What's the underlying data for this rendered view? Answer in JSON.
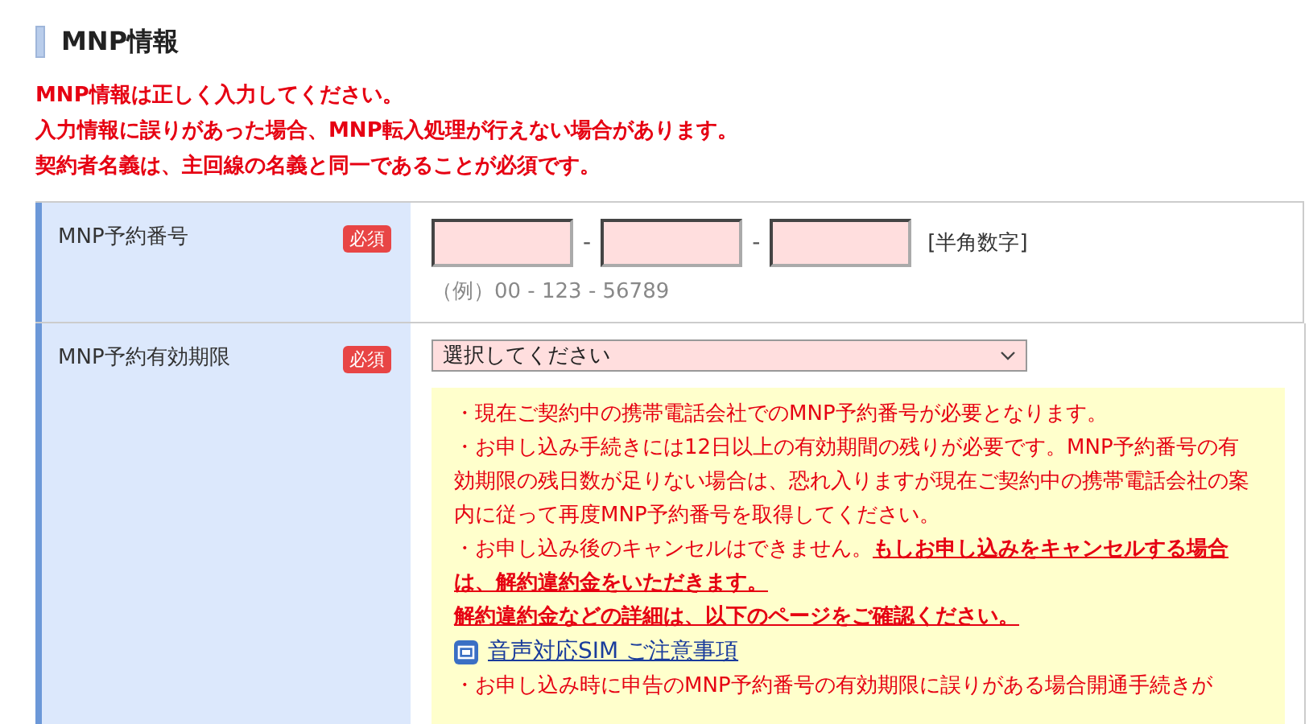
{
  "section": {
    "title": "MNP情報"
  },
  "warnings": [
    "MNP情報は正しく入力してください。",
    "入力情報に誤りがあった場合、MNP転入処理が行えない場合があります。",
    "契約者名義は、主回線の名義と同一であることが必須です。"
  ],
  "rows": [
    {
      "label": "MNP予約番号",
      "required_badge": "必須",
      "kind": "number",
      "separators": [
        "-",
        "-"
      ],
      "fields": [
        {
          "kind": "box"
        },
        {
          "kind": "box"
        },
        {
          "kind": "box"
        }
      ],
      "hint": "[半角数字]",
      "example": "（例）00 - 123 - 56789"
    },
    {
      "label": "MNP予約有効期限",
      "required_badge": "必須",
      "kind": "select",
      "select": {
        "value": "選択してください"
      },
      "notes": [
        {
          "kind": "bullet",
          "text": "・現在ご契約中の携帯電話会社でのMNP予約番号が必要となります。"
        },
        {
          "kind": "bullet",
          "text": "・お申し込み手続きには12日以上の有効期間の残りが必要です。MNP予約番号の有効期限の残日数が足りない場合は、恐れ入りますが現在ご契約中の携帯電話会社の案内に従って再度MNP予約番号を取得してください。"
        },
        {
          "kind": "bullet",
          "text": "・お申し込み後のキャンセルはできません。",
          "strong_text": "もしお申し込みをキャンセルする場合は、解約違約金をいただきます。"
        },
        {
          "kind": "emphasis",
          "text": "解約違約金などの詳細は、以下のページをご確認ください。"
        },
        {
          "kind": "link",
          "text": "音声対応SIM ご注意事項"
        },
        {
          "kind": "bullet",
          "text": "・お申し込み時に申告のMNP予約番号の有効期限に誤りがある場合開通手続きが"
        }
      ]
    }
  ]
}
